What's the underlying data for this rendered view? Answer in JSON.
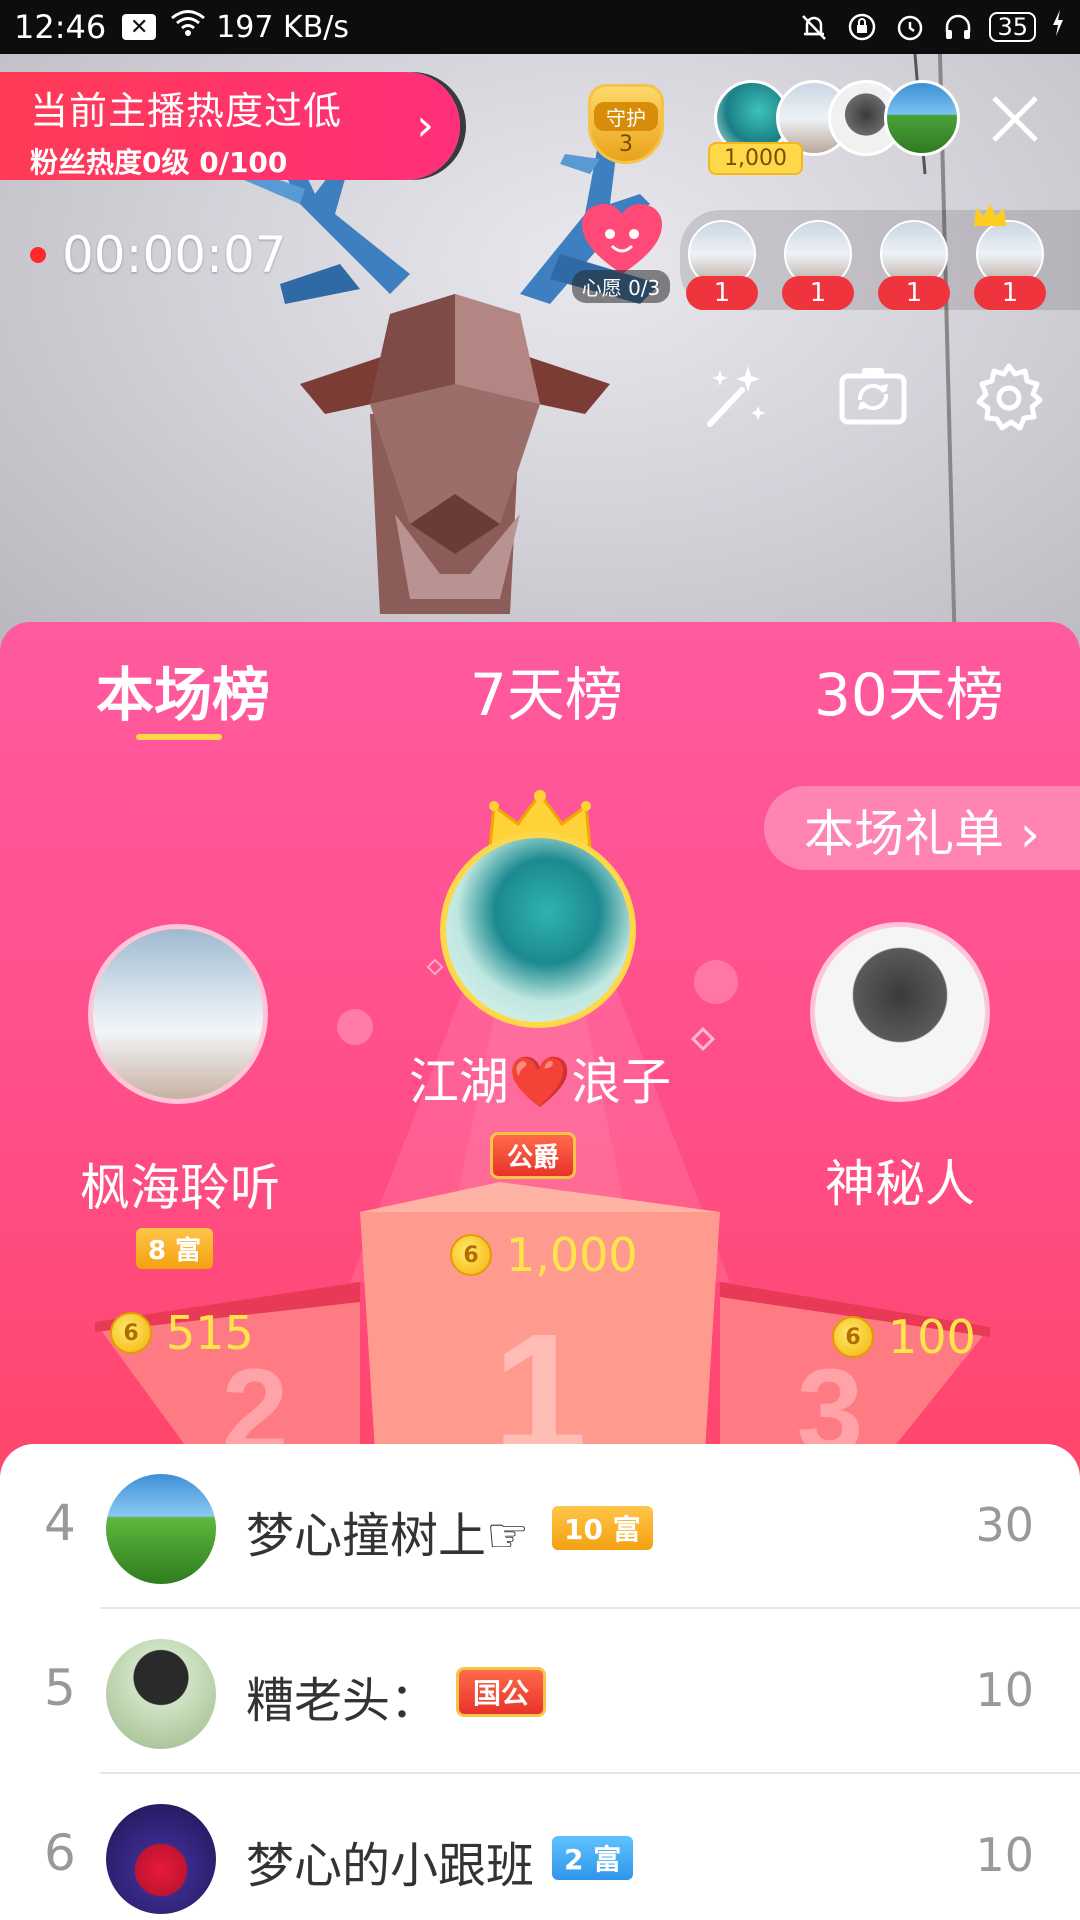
{
  "status_bar": {
    "time": "12:46",
    "net_speed": "197 KB/s",
    "battery": "35"
  },
  "live": {
    "hot_tip": {
      "title": "当前主播热度过低",
      "subtitle": "粉丝热度0级 0/100"
    },
    "guard": {
      "label": "守护",
      "count": "3"
    },
    "top_contributor_amount": "1,000",
    "timer": "00:00:07",
    "wish": {
      "label": "心愿 0/3"
    },
    "fans": [
      {
        "count": "1"
      },
      {
        "count": "1"
      },
      {
        "count": "1"
      },
      {
        "count": "1"
      }
    ],
    "icons": {
      "magic": "magic-wand-icon",
      "flip": "camera-flip-icon",
      "settings": "gear-icon",
      "close": "close-icon"
    }
  },
  "ranking": {
    "tabs": [
      {
        "label": "本场榜",
        "active": true
      },
      {
        "label": "7天榜",
        "active": false
      },
      {
        "label": "30天榜",
        "active": false
      }
    ],
    "gift_list_button": "本场礼单",
    "podium": {
      "first": {
        "name": "江湖❤️浪子",
        "badge": "公爵",
        "score": "1,000"
      },
      "second": {
        "name": "枫海聆听",
        "badge": "8 富",
        "score": "515"
      },
      "third": {
        "name": "神秘人",
        "score": "100"
      }
    },
    "list": [
      {
        "rank": "4",
        "name": "梦心撞树上☞",
        "badge": "10 富",
        "score": "30"
      },
      {
        "rank": "5",
        "name": "糟老头：",
        "badge": "国公",
        "score": "10"
      },
      {
        "rank": "6",
        "name": "梦心的小跟班",
        "badge": "2 富",
        "score": "10"
      }
    ]
  },
  "colors": {
    "panel_top": "#ff5aa0",
    "panel_bottom": "#ff3e56",
    "gold": "#ffe44a",
    "tab_underline": "#ffd84a"
  }
}
